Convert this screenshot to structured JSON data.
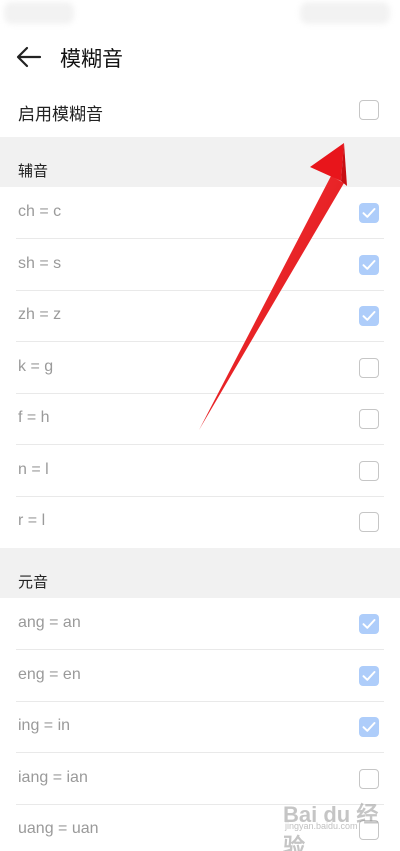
{
  "header": {
    "title": "模糊音"
  },
  "enable": {
    "label": "启用模糊音",
    "checked": false
  },
  "consonants": {
    "title": "辅音",
    "items": [
      {
        "label": "ch = c",
        "checked": true
      },
      {
        "label": "sh = s",
        "checked": true
      },
      {
        "label": "zh = z",
        "checked": true
      },
      {
        "label": "k = g",
        "checked": false
      },
      {
        "label": "f = h",
        "checked": false
      },
      {
        "label": "n = l",
        "checked": false
      },
      {
        "label": "r = l",
        "checked": false
      }
    ]
  },
  "vowels": {
    "title": "元音",
    "items": [
      {
        "label": "ang = an",
        "checked": true
      },
      {
        "label": "eng = en",
        "checked": true
      },
      {
        "label": "ing = in",
        "checked": true
      },
      {
        "label": "iang = ian",
        "checked": false
      },
      {
        "label": "uang = uan",
        "checked": false
      }
    ]
  },
  "watermark": {
    "logo": "Bai du 经验",
    "url": "jingyan.baidu.com"
  },
  "colors": {
    "check_fill": "#aecdfa",
    "arrow": "#e8151b",
    "section_bg": "#f1f1f1"
  },
  "icons": {
    "back": "arrow-left-icon",
    "check": "checkmark-icon",
    "annotation": "red-arrow-annotation"
  }
}
